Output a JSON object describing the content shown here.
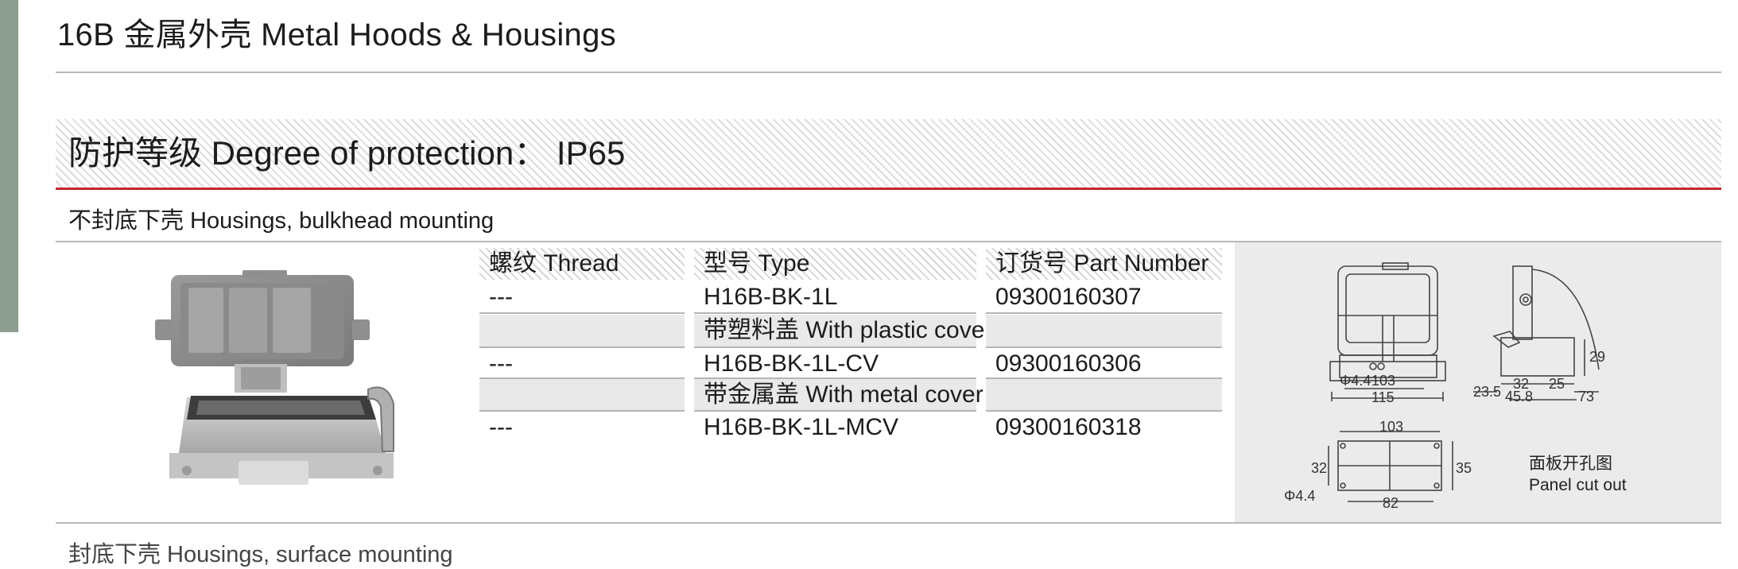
{
  "page": {
    "title": "16B 金属外壳 Metal Hoods & Housings",
    "protection": "防护等级 Degree of protection： IP65",
    "section_heading": "不封底下壳 Housings, bulkhead mounting",
    "next_section_heading": "封底下壳 Housings, surface mounting"
  },
  "table": {
    "headers": [
      "螺纹 Thread",
      "型号 Type",
      "订货号 Part Number"
    ],
    "rows": [
      {
        "thread": "---",
        "type": "H16B-BK-1L",
        "part_number": "09300160307"
      },
      {
        "thread": "",
        "type": "带塑料盖 With plastic cover",
        "part_number": ""
      },
      {
        "thread": "---",
        "type": "H16B-BK-1L-CV",
        "part_number": "09300160306"
      },
      {
        "thread": "",
        "type": "带金属盖 With metal cover",
        "part_number": ""
      },
      {
        "thread": "---",
        "type": "H16B-BK-1L-MCV",
        "part_number": "09300160318"
      }
    ]
  },
  "drawing": {
    "front_dims": {
      "hole": "Φ4.4",
      "inner": "103",
      "outer": "115"
    },
    "side_dims": {
      "d1": "23.5",
      "d2": "32",
      "d3": "45.8",
      "d4": "25",
      "d5": "73",
      "h": "29"
    },
    "cutout_dims": {
      "top": "103",
      "bottom": "82",
      "left": "32",
      "right": "35",
      "hole": "Φ4.4"
    },
    "cutout_label_cn": "面板开孔图",
    "cutout_label_en": "Panel cut out"
  },
  "colors": {
    "accent_red": "#c4262e",
    "side_bar": "#8d9d8f",
    "panel_grey": "#ebebeb"
  }
}
